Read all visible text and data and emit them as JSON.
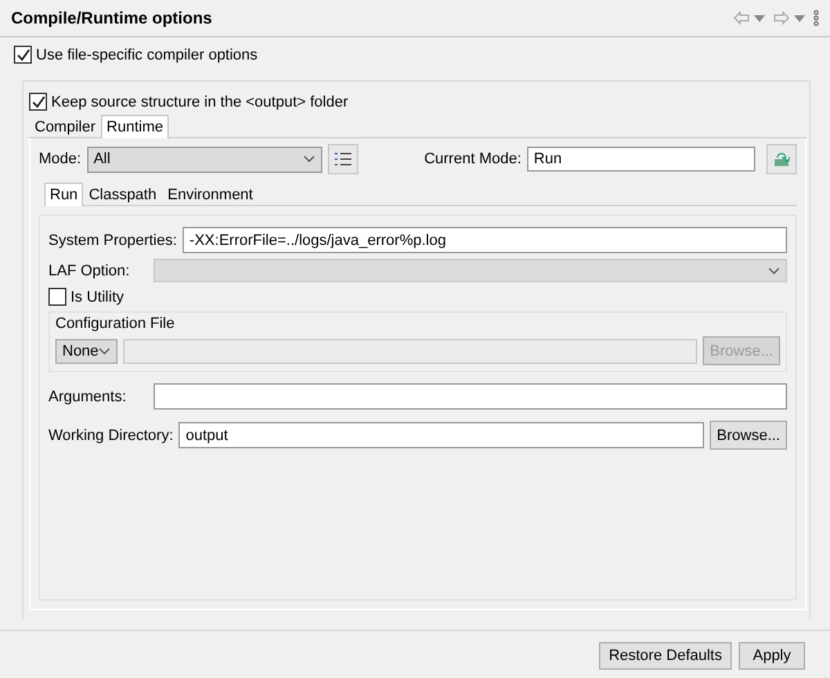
{
  "title": "Compile/Runtime options",
  "use_file_specific": {
    "label": "Use file-specific compiler options",
    "checked": true
  },
  "keep_source": {
    "label": "Keep source structure in the <output> folder",
    "checked": true
  },
  "tabs": [
    {
      "label": "Compiler",
      "selected": false
    },
    {
      "label": "Runtime",
      "selected": true
    }
  ],
  "mode": {
    "label": "Mode:",
    "value": "All"
  },
  "current_mode": {
    "label": "Current Mode:",
    "value": "Run"
  },
  "sub_tabs": [
    {
      "label": "Run",
      "selected": true
    },
    {
      "label": "Classpath",
      "selected": false
    },
    {
      "label": "Environment",
      "selected": false
    }
  ],
  "system_properties": {
    "label": "System Properties:",
    "value": "-XX:ErrorFile=../logs/java_error%p.log"
  },
  "laf_option": {
    "label": "LAF Option:",
    "disabled": true
  },
  "is_utility": {
    "label": "Is Utility",
    "checked": false
  },
  "configuration_file": {
    "legend": "Configuration File",
    "select_value": "None",
    "browse": {
      "label": "Browse...",
      "disabled": true
    }
  },
  "arguments": {
    "label": "Arguments:"
  },
  "working_directory": {
    "label": "Working Directory:",
    "value": "output",
    "browse": {
      "label": "Browse...",
      "disabled": false
    }
  },
  "buttons": [
    {
      "label": "Restore Defaults"
    },
    {
      "label": "Apply"
    }
  ]
}
